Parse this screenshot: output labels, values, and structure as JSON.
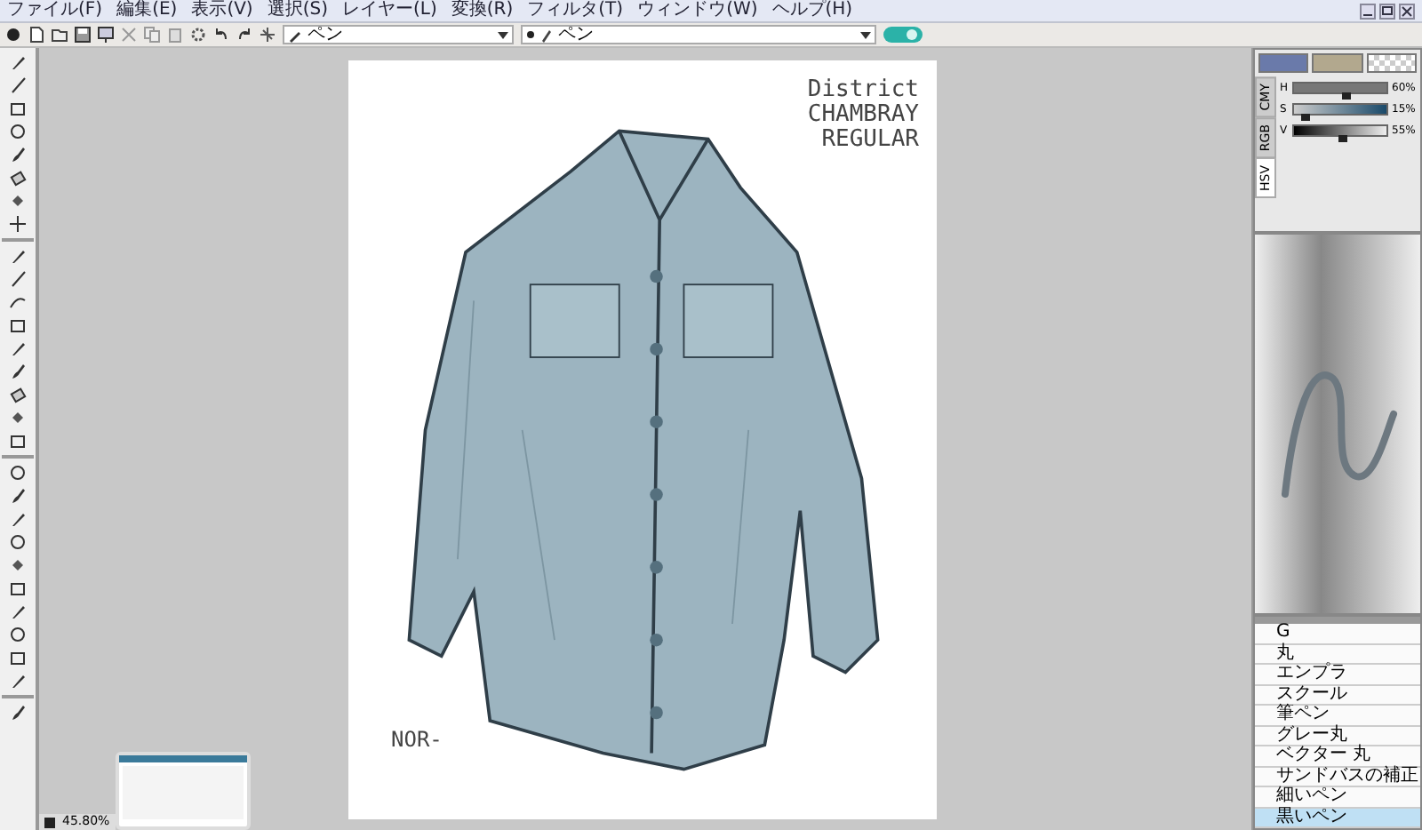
{
  "menu": [
    "ファイル(F)",
    "編集(E)",
    "表示(V)",
    "選択(S)",
    "レイヤー(L)",
    "変換(R)",
    "フィルタ(T)",
    "ウィンドウ(W)",
    "ヘルプ(H)"
  ],
  "toolbar": {
    "tool_dropdown": "ペン",
    "brush_dropdown": "ペン"
  },
  "canvas": {
    "title_lines": [
      "District",
      "CHAMBRAY",
      "REGULAR"
    ],
    "signature": "NOR-"
  },
  "color_panel": {
    "tabs": [
      {
        "label": "HSV",
        "selected": true
      },
      {
        "label": "RGB",
        "selected": false
      },
      {
        "label": "CMY",
        "selected": false
      }
    ],
    "swatches": [
      {
        "color": "#6a7aaa"
      },
      {
        "color": "#b2a88e"
      }
    ],
    "sliders": [
      {
        "label": "H",
        "level": 0.55,
        "reading": "60%"
      },
      {
        "label": "S",
        "level": 0.12,
        "reading": "15%"
      },
      {
        "label": "V",
        "level": 0.52,
        "reading": "55%"
      }
    ]
  },
  "brush_list": {
    "items": [
      {
        "label": "G",
        "selected": false
      },
      {
        "label": "丸",
        "selected": false
      },
      {
        "label": "エンプラ",
        "selected": false
      },
      {
        "label": "スクール",
        "selected": false
      },
      {
        "label": "筆ペン",
        "selected": false
      },
      {
        "label": "グレー丸",
        "selected": false
      },
      {
        "label": "ベクター 丸",
        "selected": false
      },
      {
        "label": "サンドバスの補正",
        "selected": false
      },
      {
        "label": "細いペン",
        "selected": false
      },
      {
        "label": "黒いペン",
        "selected": true
      }
    ]
  },
  "status_bar": {
    "zoom": "45.80%"
  }
}
